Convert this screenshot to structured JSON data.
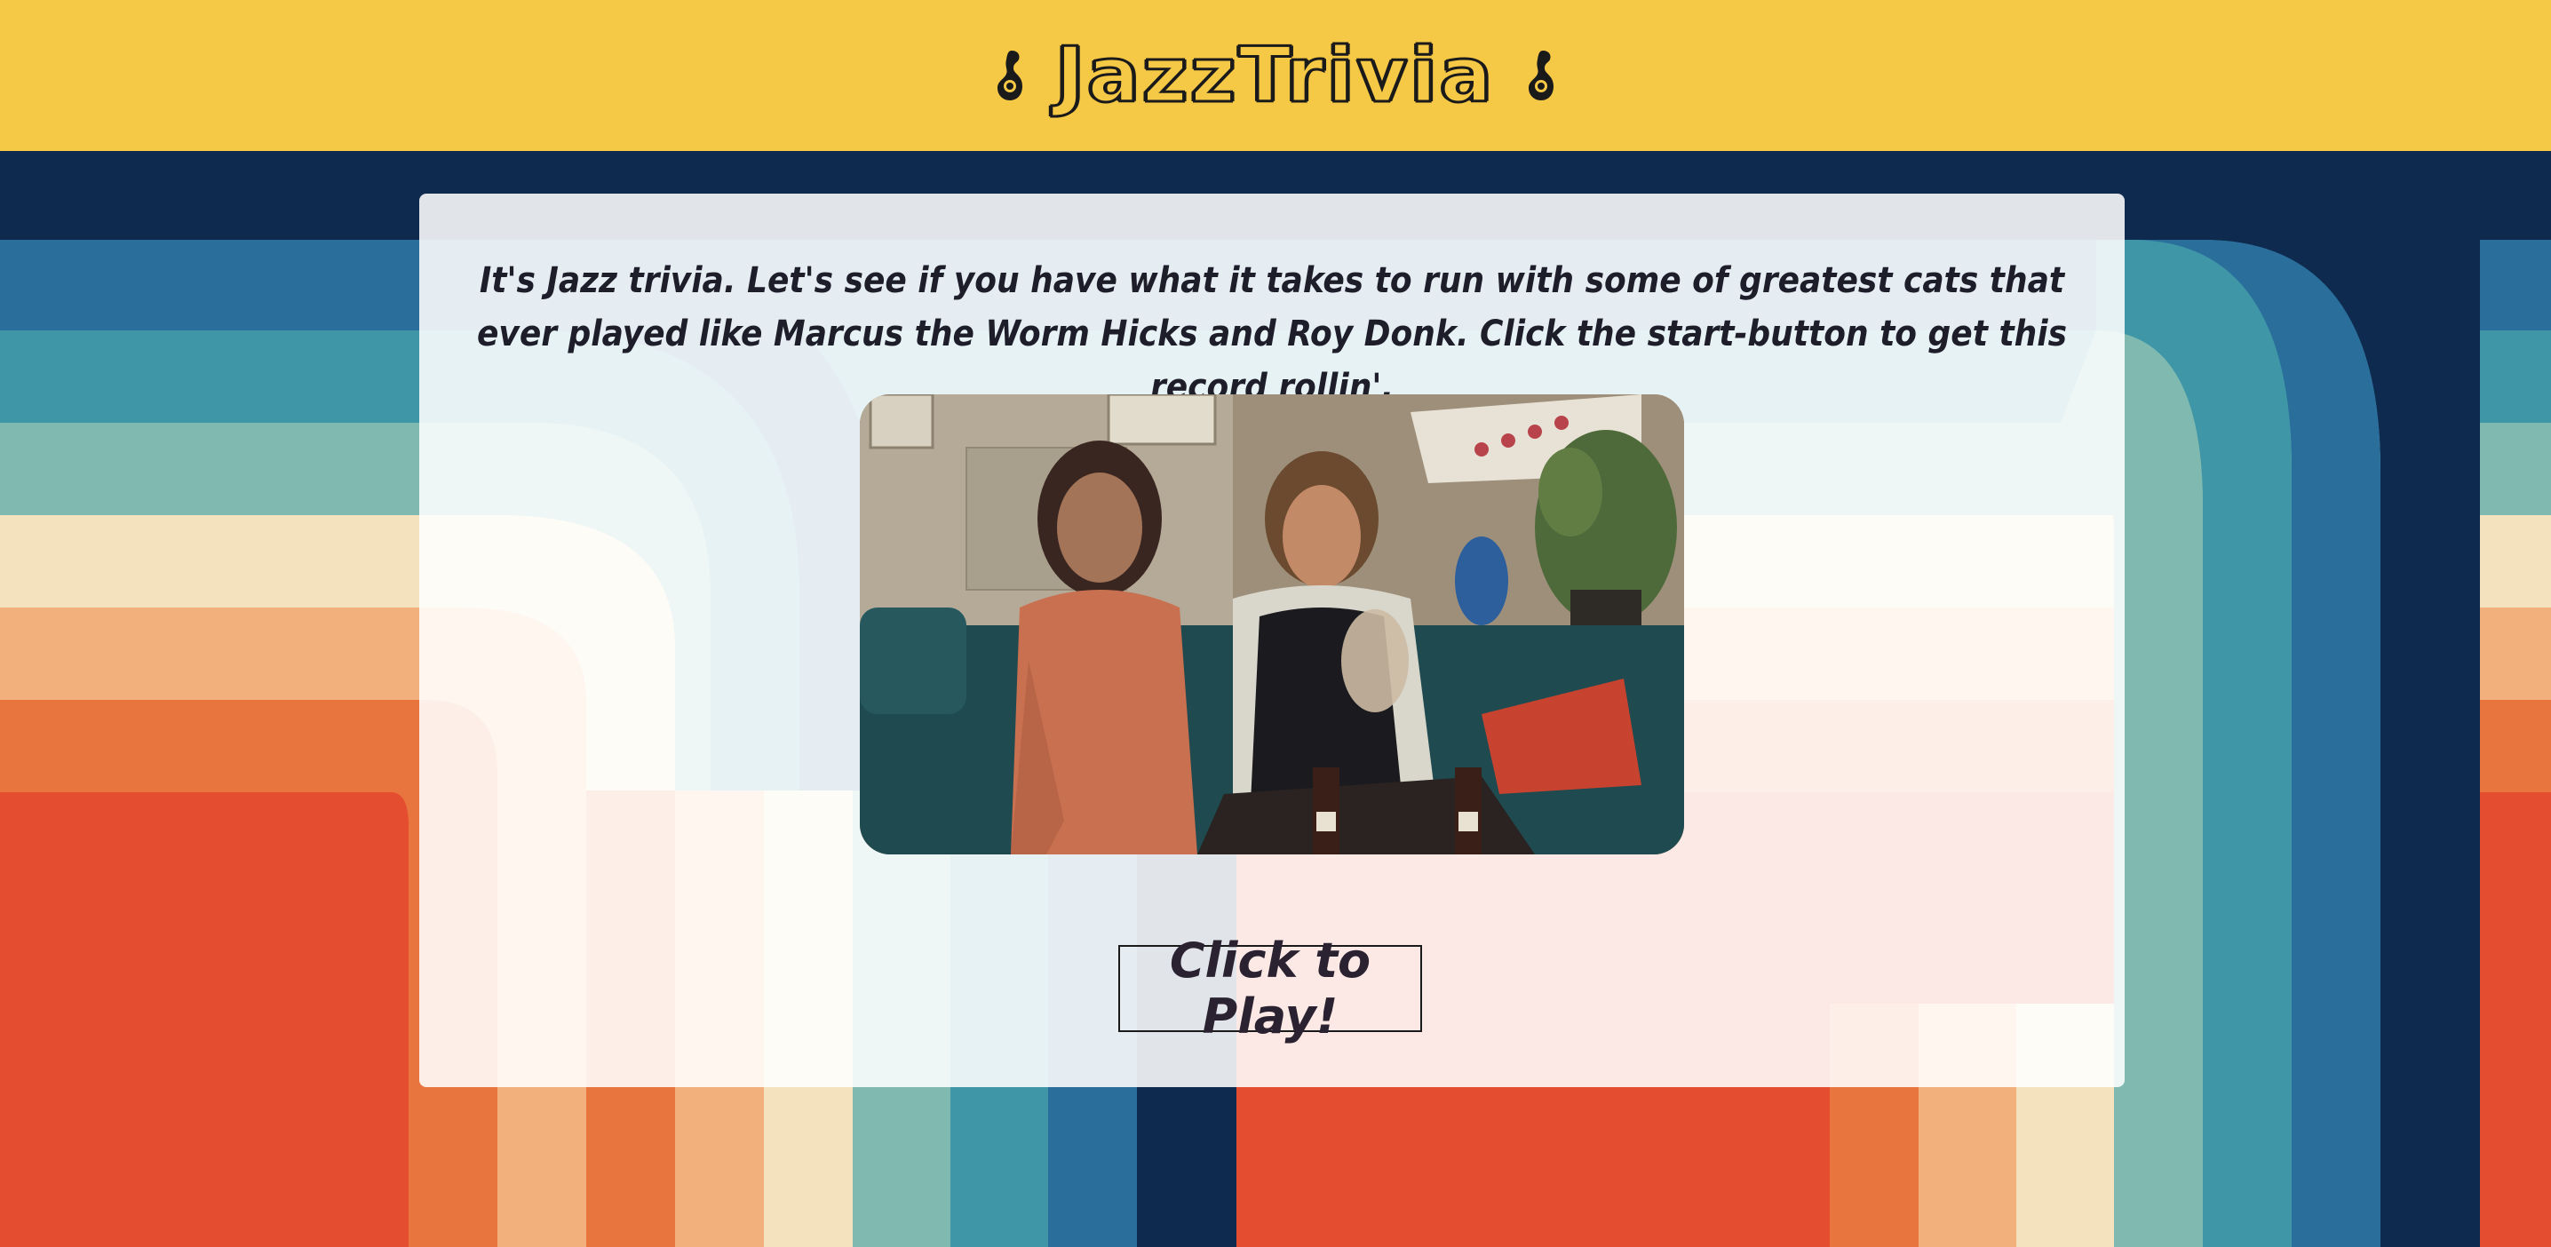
{
  "header": {
    "title": "JazzTrivia",
    "background_color": "#f5c846",
    "icons": [
      "saxophone-icon",
      "saxophone-icon"
    ]
  },
  "main": {
    "intro_text": "It's Jazz trivia. Let's see if you have what it takes to run with some of greatest cats that ever played like Marcus the Worm Hicks and Roy Donk. Click the start-button to get this record rollin'.",
    "image_description_icon": "scene-photo",
    "play_button_label": "Click to Play!"
  },
  "theme": {
    "stripe_colors": [
      "#0f2a4f",
      "#2a6f9c",
      "#3f96a6",
      "#7fb9b0",
      "#f3e2bd",
      "#f2b07c",
      "#e9753e",
      "#e44d2f"
    ]
  }
}
